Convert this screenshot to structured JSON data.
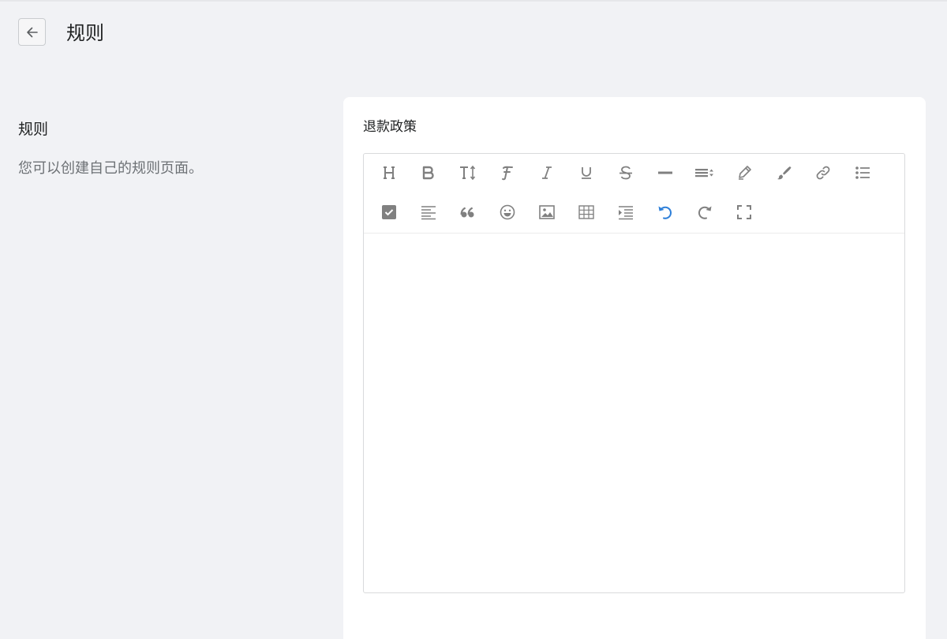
{
  "header": {
    "title": "规则"
  },
  "section": {
    "title": "规则",
    "description": "您可以创建自己的规则页面。"
  },
  "editor": {
    "label": "退款政策",
    "content": "",
    "toolbar": [
      "heading-icon",
      "bold-icon",
      "font-size-icon",
      "font-family-icon",
      "italic-icon",
      "underline-icon",
      "strikethrough-icon",
      "horizontal-rule-icon",
      "line-height-icon",
      "text-color-icon",
      "background-color-icon",
      "link-icon",
      "list-icon",
      "checkbox-icon",
      "align-left-icon",
      "quote-icon",
      "emoji-icon",
      "image-icon",
      "table-icon",
      "indent-icon",
      "undo-icon",
      "redo-icon",
      "fullscreen-icon"
    ]
  },
  "colors": {
    "background": "#f1f2f5",
    "card": "#ffffff",
    "icon": "#808080",
    "active_icon": "#2f80d9"
  }
}
